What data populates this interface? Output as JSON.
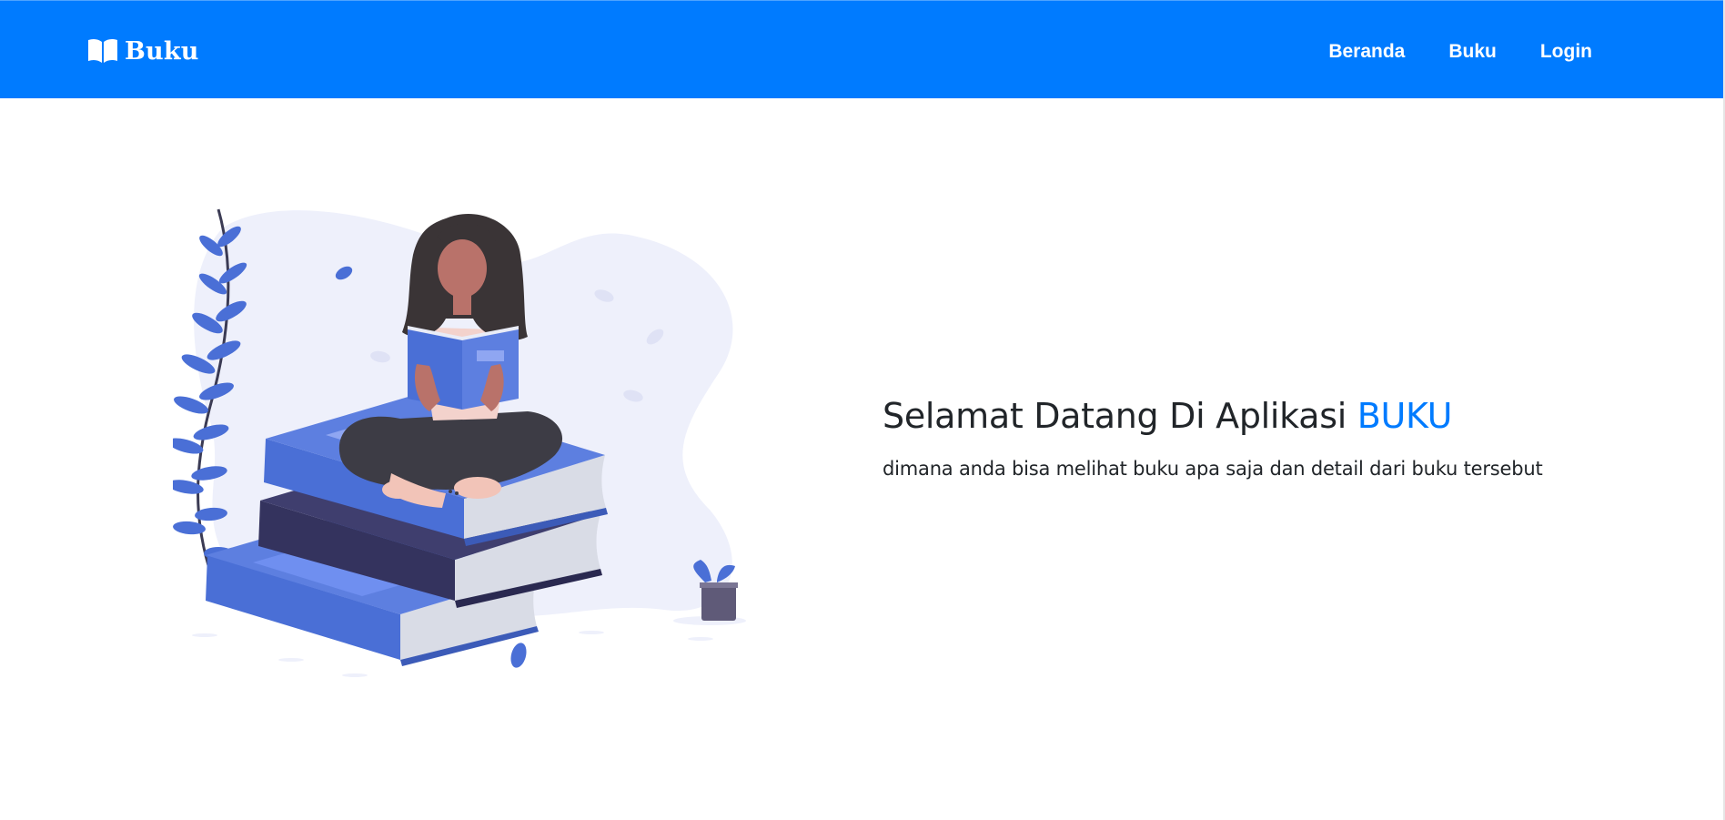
{
  "navbar": {
    "brand": {
      "icon": "open-book-icon",
      "label": "Buku"
    },
    "links": [
      {
        "label": "Beranda"
      },
      {
        "label": "Buku"
      },
      {
        "label": "Login"
      }
    ]
  },
  "hero": {
    "title": "Selamat Datang Di Aplikasi",
    "title_accent": "BUKU",
    "subtitle": "dimana anda bisa melihat buku apa saja dan detail dari buku tersebut",
    "illustration": "woman-reading-on-books-illustration"
  },
  "colors": {
    "primary": "#007bff",
    "text": "#212529",
    "book_blue": "#4a6fd6",
    "book_dark": "#32325d",
    "blob": "#eef0fb"
  }
}
